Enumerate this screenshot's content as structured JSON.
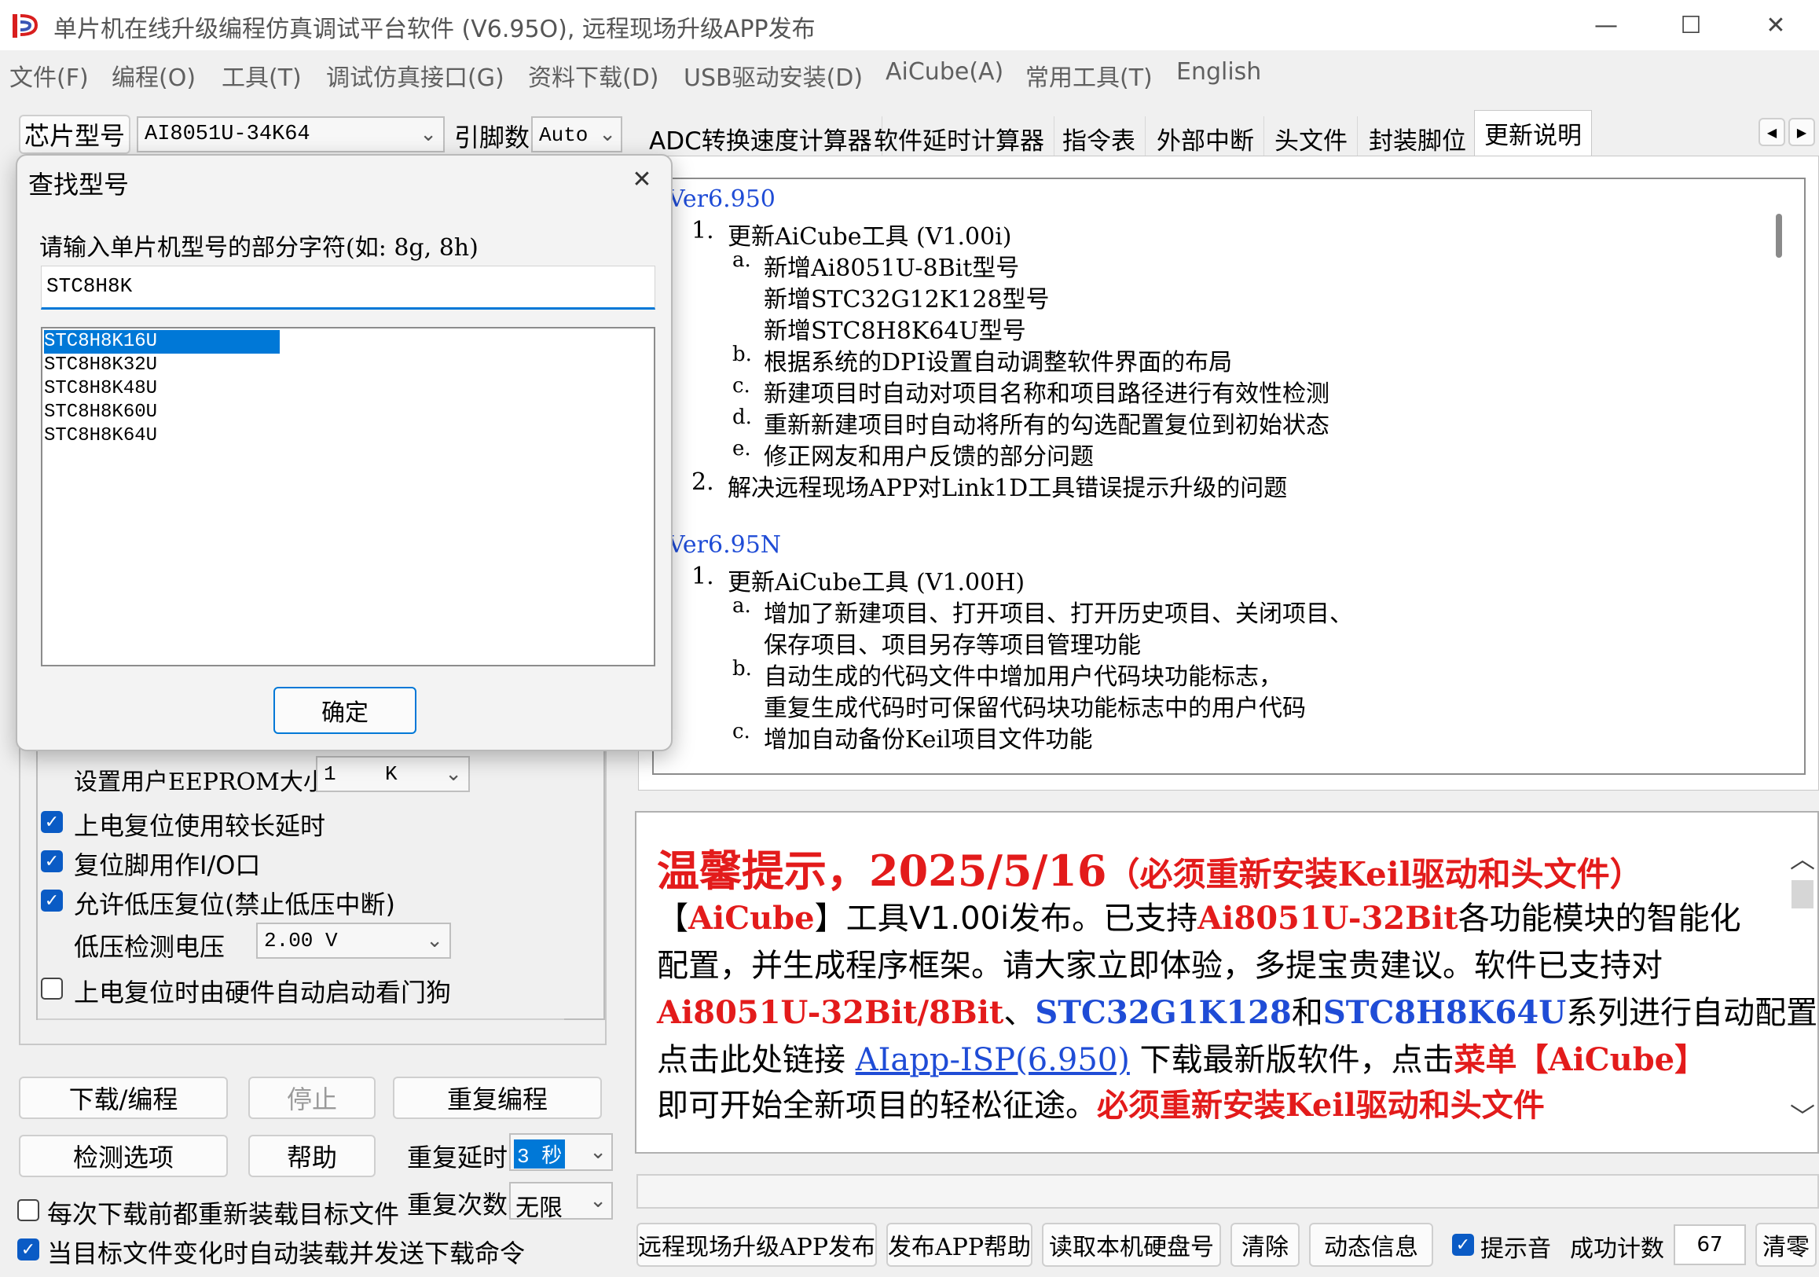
{
  "window": {
    "title": "单片机在线升级编程仿真调试平台软件 (V6.95O), 远程现场升级APP发布",
    "minimize_glyph": "—",
    "maximize_glyph": "☐",
    "close_glyph": "✕"
  },
  "menu": [
    "文件(F)",
    "编程(O)",
    "工具(T)",
    "调试仿真接口(G)",
    "资料下载(D)",
    "USB驱动安装(D)",
    "AiCube(A)",
    "常用工具(T)",
    "English"
  ],
  "chip": {
    "label": "芯片型号",
    "value": "AI8051U-34K64",
    "pin_label": "引脚数",
    "pin_value": "Auto"
  },
  "tabs": [
    "ADC转换速度计算器",
    "软件延时计算器",
    "指令表",
    "外部中断",
    "头文件",
    "封装脚位",
    "更新说明"
  ],
  "tab_nav": {
    "prev": "◀",
    "next": "▶"
  },
  "changelog": [
    {
      "version": "Ver6.950",
      "items": [
        {
          "num": "1.",
          "text": "更新AiCube工具 (V1.00i)",
          "subs": [
            {
              "letter": "a.",
              "lines": [
                "新增Ai8051U-8Bit型号",
                "新增STC32G12K128型号",
                "新增STC8H8K64U型号"
              ]
            },
            {
              "letter": "b.",
              "lines": [
                "根据系统的DPI设置自动调整软件界面的布局"
              ]
            },
            {
              "letter": "c.",
              "lines": [
                "新建项目时自动对项目名称和项目路径进行有效性检测"
              ]
            },
            {
              "letter": "d.",
              "lines": [
                "重新新建项目时自动将所有的勾选配置复位到初始状态"
              ]
            },
            {
              "letter": "e.",
              "lines": [
                "修正网友和用户反馈的部分问题"
              ]
            }
          ]
        },
        {
          "num": "2.",
          "text": "解决远程现场APP对Link1D工具错误提示升级的问题",
          "subs": []
        }
      ]
    },
    {
      "version": "Ver6.95N",
      "items": [
        {
          "num": "1.",
          "text": "更新AiCube工具 (V1.00H)",
          "subs": [
            {
              "letter": "a.",
              "lines": [
                "增加了新建项目、打开项目、打开历史项目、关闭项目、",
                "保存项目、项目另存等项目管理功能"
              ]
            },
            {
              "letter": "b.",
              "lines": [
                "自动生成的代码文件中增加用户代码块功能标志，",
                "重复生成代码时可保留代码块功能标志中的用户代码"
              ]
            },
            {
              "letter": "c.",
              "lines": [
                "增加自动备份Keil项目文件功能"
              ]
            }
          ]
        }
      ]
    }
  ],
  "options": {
    "eeprom_label": "设置用户EEPROM大小",
    "eeprom_value": "1    K",
    "checks": [
      {
        "label": "上电复位使用较长延时",
        "checked": true
      },
      {
        "label": "复位脚用作I/O口",
        "checked": true
      },
      {
        "label": "允许低压复位(禁止低压中断)",
        "checked": true
      }
    ],
    "lv_label": "低压检测电压",
    "lv_value": "2.00 V",
    "watchdog": {
      "label": "上电复位时由硬件自动启动看门狗",
      "checked": false
    }
  },
  "buttons": {
    "download": "下载/编程",
    "stop": "停止",
    "reprogram": "重复编程",
    "check_options": "检测选项",
    "help": "帮助"
  },
  "repeat": {
    "delay_label": "重复延时",
    "delay_value": "3 秒",
    "count_label": "重复次数",
    "count_value": "无限"
  },
  "bottom_checks": [
    {
      "label": "每次下载前都重新装载目标文件",
      "checked": false
    },
    {
      "label": "当目标文件变化时自动装载并发送下载命令",
      "checked": true
    }
  ],
  "notice": {
    "headline": "温馨提示，2025/5/16",
    "headline_note": "（必须重新安装Keil驱动和头文件）",
    "l2_a": "【",
    "l2_b": "AiCube",
    "l2_c": "】工具V1.00i发布。已支持",
    "l2_d": "Ai8051U-32Bit",
    "l2_e": "各功能模块的智能化",
    "l3": "配置，并生成程序框架。请大家立即体验，多提宝贵建议。软件已支持对",
    "l4_a": "Ai8051U-32Bit/8Bit",
    "l4_b": "、",
    "l4_c": "STC32G1K128",
    "l4_d": "和",
    "l4_e": "STC8H8K64U",
    "l4_f": "系列进行自动配置 。",
    "l5_a": "点击此处链接 ",
    "l5_link": "AIapp-ISP(6.950)",
    "l5_b": " 下载最新版软件，点击",
    "l5_c": "菜单【AiCube】",
    "l6_a": "即可开始全新项目的轻松征途。",
    "l6_b": "必须重新安装Keil驱动和头文件"
  },
  "footer": {
    "btn_remote": "远程现场升级APP发布",
    "btn_publish_help": "发布APP帮助",
    "btn_read_disk": "读取本机硬盘号",
    "btn_clear": "清除",
    "btn_dynamic": "动态信息",
    "sound_label": "提示音",
    "sound_checked": true,
    "success_label": "成功计数",
    "success_count": "67",
    "btn_zero": "清零"
  },
  "dialog": {
    "title": "查找型号",
    "prompt": "请输入单片机型号的部分字符(如: 8g, 8h)",
    "input_value": "STC8H8K",
    "results": [
      "STC8H8K16U",
      "STC8H8K32U",
      "STC8H8K48U",
      "STC8H8K60U",
      "STC8H8K64U"
    ],
    "selected_index": 0,
    "ok": "确定",
    "close_glyph": "✕"
  },
  "colors": {
    "accent": "#0078d7",
    "notice_red": "#e31b1b",
    "notice_blue": "#1f4cd6",
    "link": "#1f4cd6"
  }
}
